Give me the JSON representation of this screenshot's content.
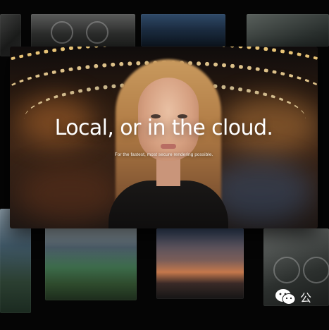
{
  "hero": {
    "title": "Local, or in the cloud.",
    "subtitle": "For the fastest, most secure rendering possible."
  },
  "gallery": {
    "top_row": [
      "street-bicycle-scene",
      "mountain-lake-scene",
      "landscape-scene"
    ],
    "bottom_row": [
      "mountain-scene",
      "valley-lake-scene",
      "sunset-scene",
      "bicycle-scene"
    ]
  },
  "watermark": {
    "icon": "wechat-icon",
    "text": "公"
  },
  "colors": {
    "background": "#050505",
    "title": "#ffffff",
    "accent_light": "#ffd782"
  }
}
